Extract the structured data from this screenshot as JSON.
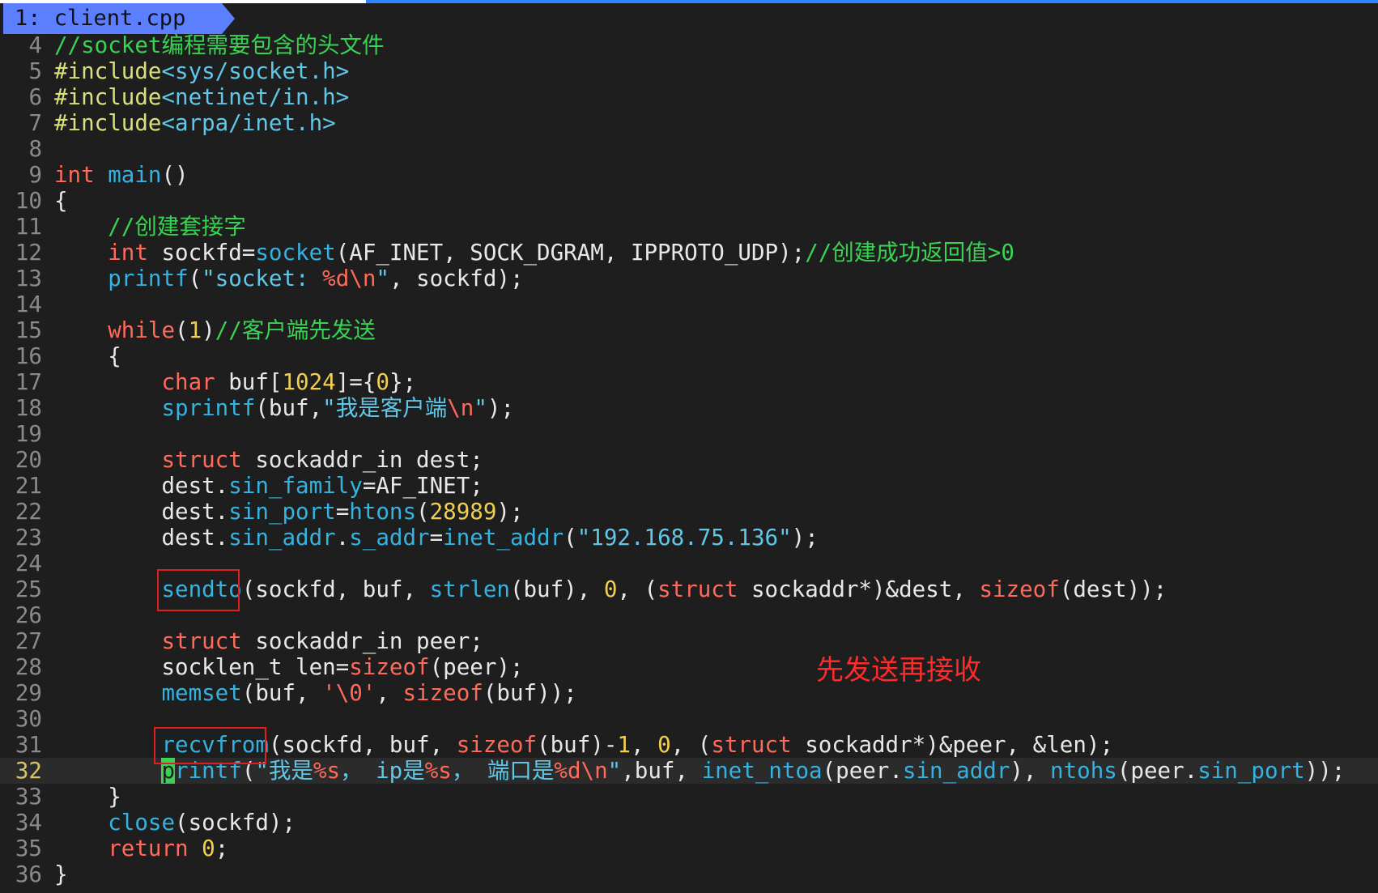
{
  "tab": {
    "label": "1: client.cpp"
  },
  "annotation": "先发送再接收",
  "current_line": 32,
  "lines": [
    {
      "n": "4",
      "tokens": [
        [
          "c",
          "//socket编程需要包含的头文件"
        ]
      ]
    },
    {
      "n": "5",
      "tokens": [
        [
          "p",
          "#include"
        ],
        [
          "s",
          "<sys/socket.h>"
        ]
      ]
    },
    {
      "n": "6",
      "tokens": [
        [
          "p",
          "#include"
        ],
        [
          "s",
          "<netinet/in.h>"
        ]
      ]
    },
    {
      "n": "7",
      "tokens": [
        [
          "p",
          "#include"
        ],
        [
          "s",
          "<arpa/inet.h>"
        ]
      ]
    },
    {
      "n": "8",
      "tokens": []
    },
    {
      "n": "9",
      "tokens": [
        [
          "k",
          "int"
        ],
        [
          "t",
          " "
        ],
        [
          "f",
          "main"
        ],
        [
          "t",
          "()"
        ]
      ]
    },
    {
      "n": "10",
      "tokens": [
        [
          "t",
          "{"
        ]
      ]
    },
    {
      "n": "11",
      "tokens": [
        [
          "t",
          "    "
        ],
        [
          "c",
          "//创建套接字"
        ]
      ]
    },
    {
      "n": "12",
      "tokens": [
        [
          "t",
          "    "
        ],
        [
          "k",
          "int"
        ],
        [
          "t",
          " sockfd="
        ],
        [
          "f",
          "socket"
        ],
        [
          "t",
          "(AF_INET, SOCK_DGRAM, IPPROTO_UDP);"
        ],
        [
          "c",
          "//创建成功返回值>0"
        ]
      ]
    },
    {
      "n": "13",
      "tokens": [
        [
          "t",
          "    "
        ],
        [
          "f",
          "printf"
        ],
        [
          "t",
          "("
        ],
        [
          "s",
          "\"socket: "
        ],
        [
          "e",
          "%d\\n"
        ],
        [
          "s",
          "\""
        ],
        [
          "t",
          ", sockfd);"
        ]
      ]
    },
    {
      "n": "14",
      "tokens": []
    },
    {
      "n": "15",
      "tokens": [
        [
          "t",
          "    "
        ],
        [
          "k",
          "while"
        ],
        [
          "t",
          "("
        ],
        [
          "m",
          "1"
        ],
        [
          "t",
          ")"
        ],
        [
          "c",
          "//客户端先发送"
        ]
      ]
    },
    {
      "n": "16",
      "tokens": [
        [
          "t",
          "    {"
        ]
      ]
    },
    {
      "n": "17",
      "tokens": [
        [
          "t",
          "        "
        ],
        [
          "k",
          "char"
        ],
        [
          "t",
          " buf["
        ],
        [
          "m",
          "1024"
        ],
        [
          "t",
          "]={"
        ],
        [
          "m",
          "0"
        ],
        [
          "t",
          "};"
        ]
      ]
    },
    {
      "n": "18",
      "tokens": [
        [
          "t",
          "        "
        ],
        [
          "f",
          "sprintf"
        ],
        [
          "t",
          "(buf,"
        ],
        [
          "s",
          "\"我是客户端"
        ],
        [
          "e",
          "\\n"
        ],
        [
          "s",
          "\""
        ],
        [
          "t",
          ");"
        ]
      ]
    },
    {
      "n": "19",
      "tokens": []
    },
    {
      "n": "20",
      "tokens": [
        [
          "t",
          "        "
        ],
        [
          "k",
          "struct"
        ],
        [
          "t",
          " sockaddr_in dest;"
        ]
      ]
    },
    {
      "n": "21",
      "tokens": [
        [
          "t",
          "        dest."
        ],
        [
          "f",
          "sin_family"
        ],
        [
          "t",
          "=AF_INET;"
        ]
      ]
    },
    {
      "n": "22",
      "tokens": [
        [
          "t",
          "        dest."
        ],
        [
          "f",
          "sin_port"
        ],
        [
          "t",
          "="
        ],
        [
          "f",
          "htons"
        ],
        [
          "t",
          "("
        ],
        [
          "m",
          "28989"
        ],
        [
          "t",
          ");"
        ]
      ]
    },
    {
      "n": "23",
      "tokens": [
        [
          "t",
          "        dest."
        ],
        [
          "f",
          "sin_addr"
        ],
        [
          "t",
          "."
        ],
        [
          "f",
          "s_addr"
        ],
        [
          "t",
          "="
        ],
        [
          "f",
          "inet_addr"
        ],
        [
          "t",
          "("
        ],
        [
          "s",
          "\"192.168.75.136\""
        ],
        [
          "t",
          ");"
        ]
      ]
    },
    {
      "n": "24",
      "tokens": []
    },
    {
      "n": "25",
      "tokens": [
        [
          "t",
          "        "
        ],
        [
          "f",
          "sendto"
        ],
        [
          "t",
          "(sockfd, buf, "
        ],
        [
          "f",
          "strlen"
        ],
        [
          "t",
          "(buf), "
        ],
        [
          "m",
          "0"
        ],
        [
          "t",
          ", ("
        ],
        [
          "k",
          "struct"
        ],
        [
          "t",
          " sockaddr*)&dest, "
        ],
        [
          "k",
          "sizeof"
        ],
        [
          "t",
          "(dest));"
        ]
      ]
    },
    {
      "n": "26",
      "tokens": []
    },
    {
      "n": "27",
      "tokens": [
        [
          "t",
          "        "
        ],
        [
          "k",
          "struct"
        ],
        [
          "t",
          " sockaddr_in peer;"
        ]
      ]
    },
    {
      "n": "28",
      "tokens": [
        [
          "t",
          "        socklen_t len="
        ],
        [
          "k",
          "sizeof"
        ],
        [
          "t",
          "(peer);"
        ]
      ]
    },
    {
      "n": "29",
      "tokens": [
        [
          "t",
          "        "
        ],
        [
          "f",
          "memset"
        ],
        [
          "t",
          "(buf, "
        ],
        [
          "k",
          "'\\0'"
        ],
        [
          "t",
          ", "
        ],
        [
          "k",
          "sizeof"
        ],
        [
          "t",
          "(buf));"
        ]
      ]
    },
    {
      "n": "30",
      "tokens": []
    },
    {
      "n": "31",
      "tokens": [
        [
          "t",
          "        "
        ],
        [
          "f",
          "recvfrom"
        ],
        [
          "t",
          "(sockfd, buf, "
        ],
        [
          "k",
          "sizeof"
        ],
        [
          "t",
          "(buf)-"
        ],
        [
          "m",
          "1"
        ],
        [
          "t",
          ", "
        ],
        [
          "m",
          "0"
        ],
        [
          "t",
          ", ("
        ],
        [
          "k",
          "struct"
        ],
        [
          "t",
          " sockaddr*)&peer, &len);"
        ]
      ]
    },
    {
      "n": "32",
      "tokens": [
        [
          "t",
          "        "
        ],
        [
          "x",
          "p"
        ],
        [
          "f",
          "rintf"
        ],
        [
          "t",
          "("
        ],
        [
          "s",
          "\"我是"
        ],
        [
          "e",
          "%s"
        ],
        [
          "s",
          "， ip是"
        ],
        [
          "e",
          "%s"
        ],
        [
          "s",
          "， 端口是"
        ],
        [
          "e",
          "%d\\n"
        ],
        [
          "s",
          "\""
        ],
        [
          "t",
          ",buf, "
        ],
        [
          "f",
          "inet_ntoa"
        ],
        [
          "t",
          "(peer."
        ],
        [
          "f",
          "sin_addr"
        ],
        [
          "t",
          "), "
        ],
        [
          "f",
          "ntohs"
        ],
        [
          "t",
          "(peer."
        ],
        [
          "f",
          "sin_port"
        ],
        [
          "t",
          "));"
        ]
      ]
    },
    {
      "n": "33",
      "tokens": [
        [
          "t",
          "    }"
        ]
      ]
    },
    {
      "n": "34",
      "tokens": [
        [
          "t",
          "    "
        ],
        [
          "f",
          "close"
        ],
        [
          "t",
          "(sockfd);"
        ]
      ]
    },
    {
      "n": "35",
      "tokens": [
        [
          "t",
          "    "
        ],
        [
          "k",
          "return"
        ],
        [
          "t",
          " "
        ],
        [
          "m",
          "0"
        ],
        [
          "t",
          ";"
        ]
      ]
    },
    {
      "n": "36",
      "tokens": [
        [
          "t",
          "}"
        ]
      ]
    }
  ]
}
